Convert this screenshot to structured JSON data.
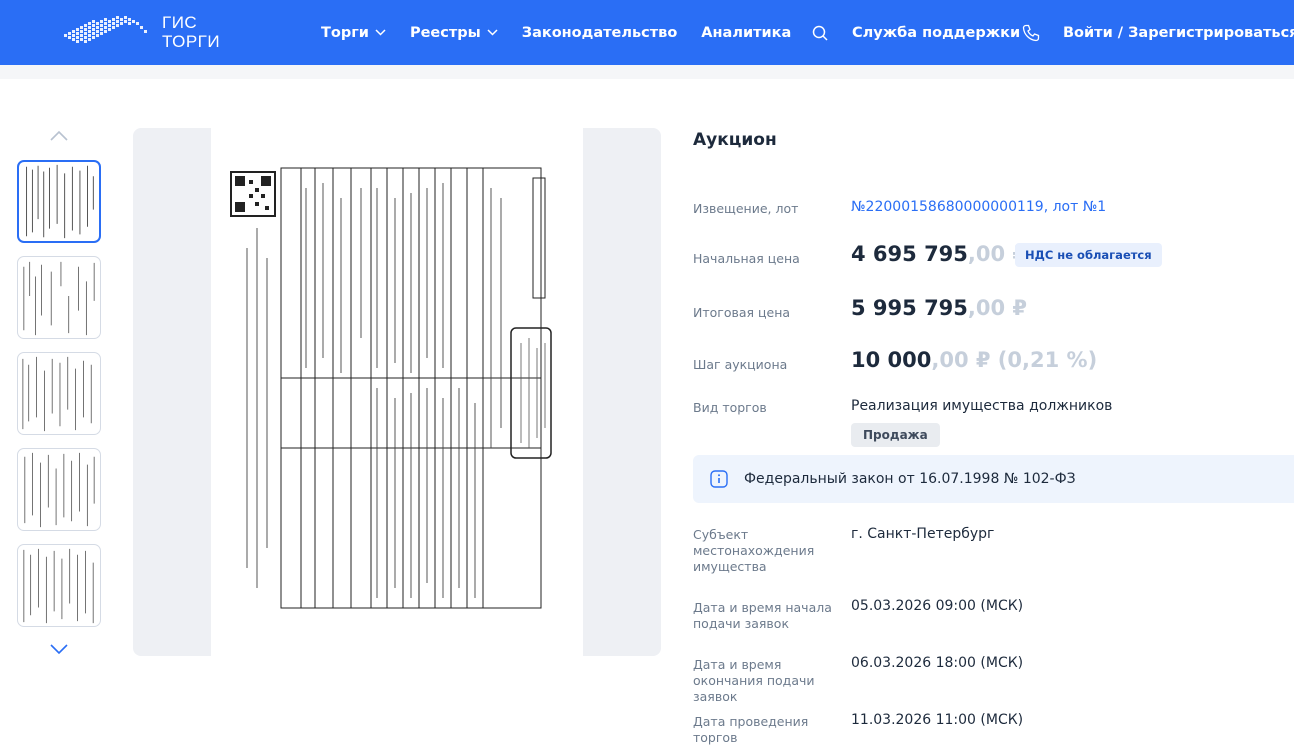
{
  "header": {
    "logo_line1": "ГИС",
    "logo_line2": "ТОРГИ",
    "nav": [
      {
        "label": "Торги",
        "has_dropdown": true
      },
      {
        "label": "Реестры",
        "has_dropdown": true
      },
      {
        "label": "Законодательство",
        "has_dropdown": false
      },
      {
        "label": "Аналитика",
        "has_dropdown": false
      }
    ],
    "search_icon": "search-icon",
    "support_label": "Служба поддержки",
    "phone_icon": "phone-icon",
    "login_label": "Войти / Зарегистрироваться",
    "brand_color": "#2a6ef5"
  },
  "gallery": {
    "thumbnail_count": 5,
    "active_index": 0
  },
  "lot": {
    "type_title": "Аукцион",
    "notice_label": "Извещение, лот",
    "notice_value": "№22000158680000000119, лот №1",
    "start_price_label": "Начальная цена",
    "start_price_main": "4 695 795",
    "start_price_tail": ",00 ₽",
    "vat_badge": "НДС не облагается",
    "final_price_label": "Итоговая цена",
    "final_price_main": "5 995 795",
    "final_price_tail": ",00 ₽",
    "step_label": "Шаг аукциона",
    "step_main": "10 000",
    "step_tail": ",00 ₽ (0,21 %)",
    "auction_kind_label": "Вид торгов",
    "auction_kind_value": "Реализация имущества должников",
    "sale_badge": "Продажа",
    "law_text": "Федеральный закон от 16.07.1998 № 102-ФЗ",
    "location_label": "Субъект местонахождения имущества",
    "location_value": "г. Санкт-Петербург",
    "apply_start_label": "Дата и время начала подачи заявок",
    "apply_start_value": "05.03.2026 09:00 (МСК)",
    "apply_end_label": "Дата и время окончания подачи заявок",
    "apply_end_value": "06.03.2026 18:00 (МСК)",
    "auction_date_label": "Дата проведения торгов",
    "auction_date_value": "11.03.2026 11:00 (МСК)"
  }
}
